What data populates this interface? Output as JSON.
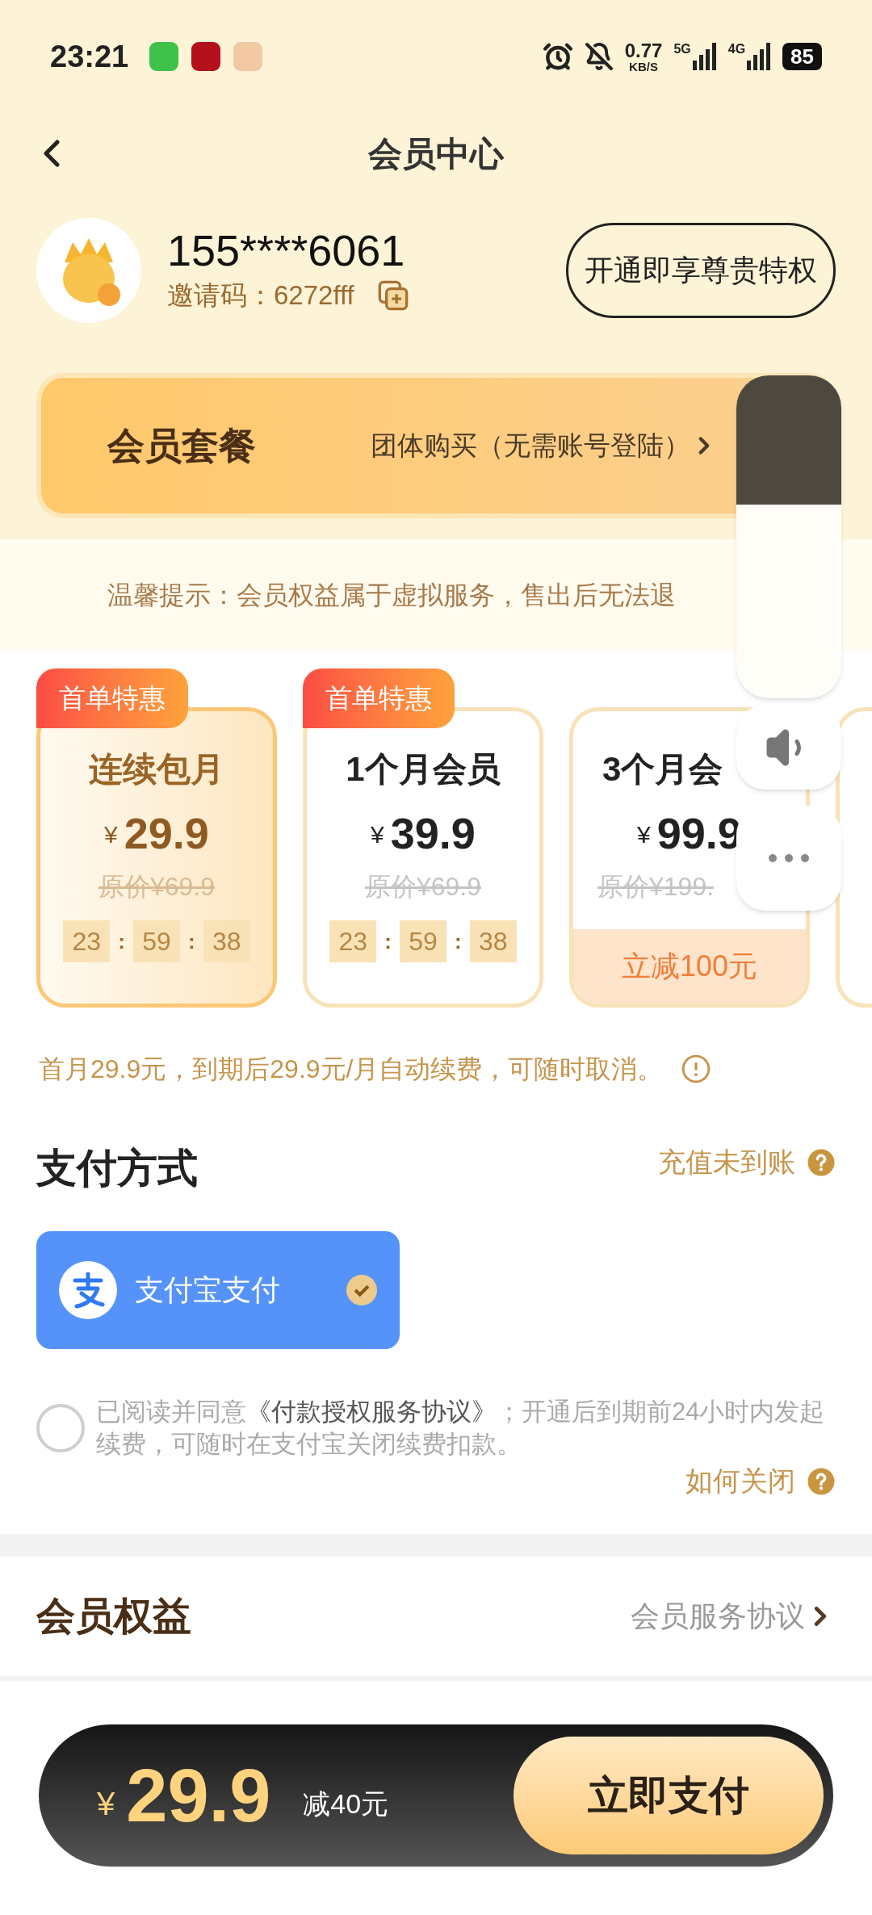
{
  "status_bar": {
    "time": "23:21",
    "speed": "0.77",
    "speed_unit": "KB/S",
    "net1": "5G",
    "net2": "4G",
    "battery": "85"
  },
  "header": {
    "title": "会员中心"
  },
  "profile": {
    "phone": "155****6061",
    "invite_label": "邀请码：",
    "invite_code": "6272fff",
    "cta": "开通即享尊贵特权"
  },
  "banner": {
    "title": "会员套餐",
    "link": "团体购买（无需账号登陆）"
  },
  "notice": "温馨提示：会员权益属于虚拟服务，售出后无法退",
  "countdown_separator": ":",
  "plans": [
    {
      "kind": "countdown",
      "badge": "首单特惠",
      "title": "连续包月",
      "currency": "¥",
      "price": "29.9",
      "original": "原价¥69.9",
      "countdown": [
        "23",
        "59",
        "38"
      ],
      "selected": true
    },
    {
      "kind": "countdown",
      "badge": "首单特惠",
      "title": "1个月会员",
      "currency": "¥",
      "price": "39.9",
      "original": "原价¥69.9",
      "countdown": [
        "23",
        "59",
        "38"
      ],
      "selected": false
    },
    {
      "kind": "discount",
      "title": "3个月会",
      "currency": "¥",
      "price": "99.9",
      "original": "原价¥199.",
      "discount": "立减100元",
      "selected": false
    }
  ],
  "renew_note": "首月29.9元，到期后29.9元/月自动续费，可随时取消。",
  "payment": {
    "title": "支付方式",
    "help": "充值未到账",
    "methods": [
      {
        "label": "支付宝支付",
        "selected": true
      }
    ]
  },
  "agreement": {
    "checked": false,
    "text": "已阅读并同意",
    "link": "《付款授权服务协议》",
    "rest": "；开通后到期前24小时内发起续费，可随时在支付宝关闭续费扣款。",
    "help": "如何关闭"
  },
  "benefits": {
    "title": "会员权益",
    "link": "会员服务协议"
  },
  "pay_bar": {
    "currency": "¥",
    "amount": "29.9",
    "saving": "减40元",
    "button": "立即支付"
  }
}
